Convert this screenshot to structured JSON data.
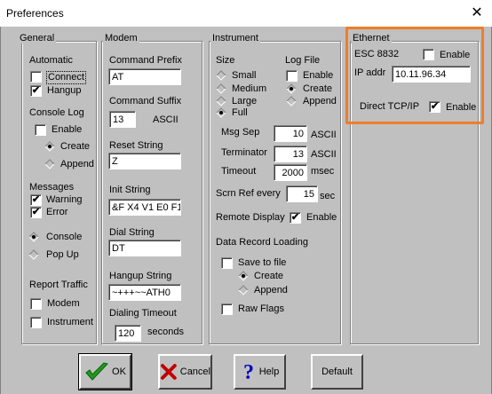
{
  "window": {
    "title": "Preferences",
    "close_glyph": "✕"
  },
  "general": {
    "title": "General",
    "automatic_label": "Automatic",
    "connect": {
      "label": "Connect",
      "checked": false
    },
    "hangup": {
      "label": "Hangup",
      "checked": true
    },
    "console_log_label": "Console Log",
    "enable": {
      "label": "Enable",
      "checked": false
    },
    "create_label": "Create",
    "append_label": "Append",
    "console_log_mode": "Create",
    "messages_label": "Messages",
    "warning": {
      "label": "Warning",
      "checked": true
    },
    "error": {
      "label": "Error",
      "checked": true
    },
    "console_radio_label": "Console",
    "popup_radio_label": "Pop Up",
    "messages_mode": "Console",
    "report_traffic_label": "Report Traffic",
    "modem_cb": {
      "label": "Modem",
      "checked": false
    },
    "instrument_cb": {
      "label": "Instrument",
      "checked": false
    }
  },
  "modem": {
    "title": "Modem",
    "command_prefix_label": "Command Prefix",
    "command_prefix_value": "AT",
    "command_suffix_label": "Command Suffix",
    "command_suffix_value": "13",
    "ascii_label": "ASCII",
    "reset_string_label": "Reset String",
    "reset_string_value": "Z",
    "init_string_label": "Init String",
    "init_string_value": "&F X4 V1 E0 F1",
    "dial_string_label": "Dial String",
    "dial_string_value": "DT",
    "hangup_string_label": "Hangup String",
    "hangup_string_value": "~+++~~ATH0",
    "dialing_timeout_label": "Dialing Timeout",
    "dialing_timeout_value": "120",
    "seconds_label": "seconds"
  },
  "instrument": {
    "title": "Instrument",
    "size_label": "Size",
    "size_small": "Small",
    "size_medium": "Medium",
    "size_large": "Large",
    "size_full": "Full",
    "size_selected": "Full",
    "log_file_label": "Log File",
    "log_enable": {
      "label": "Enable",
      "checked": false
    },
    "log_create": "Create",
    "log_append": "Append",
    "log_mode": "Create",
    "msg_sep_label": "Msg Sep",
    "msg_sep_value": "10",
    "terminator_label": "Terminator",
    "terminator_value": "13",
    "ascii_label": "ASCII",
    "timeout_label": "Timeout",
    "timeout_value": "2000",
    "msec_label": "msec",
    "scrn_ref_label": "Scrn Ref every",
    "scrn_ref_value": "15",
    "sec_label": "sec",
    "remote_display_label": "Remote Display",
    "remote_enable": {
      "label": "Enable",
      "checked": true
    },
    "data_record_label": "Data Record Loading",
    "save_to_file": {
      "label": "Save to file",
      "checked": false
    },
    "dr_create": "Create",
    "dr_append": "Append",
    "dr_mode": "Create",
    "raw_flags": {
      "label": "Raw Flags",
      "checked": false
    }
  },
  "ethernet": {
    "title": "Ethernet",
    "esc_label": "ESC 8832",
    "esc_enable": {
      "label": "Enable",
      "checked": false
    },
    "ip_label": "IP addr",
    "ip_value": "10.11.96.34",
    "direct_label": "Direct TCP/IP",
    "direct_enable": {
      "label": "Enable",
      "checked": true
    },
    "highlight_color": "#f07d2a"
  },
  "buttons": {
    "ok": "OK",
    "cancel": "Cancel",
    "help": "Help",
    "default": "Default"
  },
  "check_glyph": "✔"
}
